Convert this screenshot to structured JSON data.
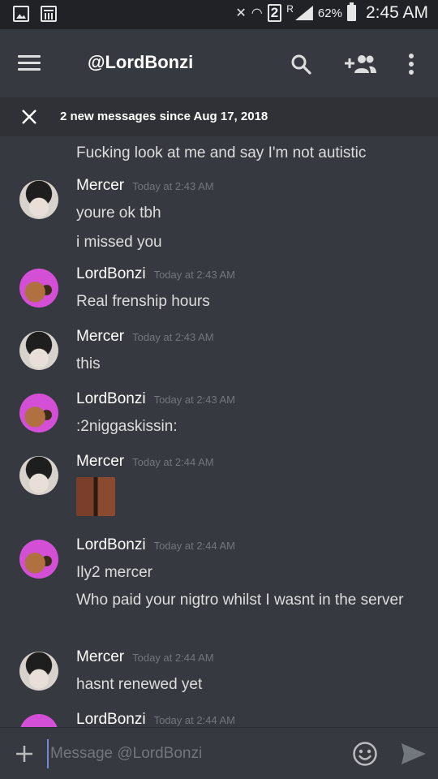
{
  "status_bar": {
    "sim_label": "2",
    "roaming": "R",
    "battery": "62%",
    "time": "2:45 AM"
  },
  "app_bar": {
    "title": "@LordBonzi"
  },
  "new_messages_bar": {
    "text": "2 new messages since Aug 17, 2018"
  },
  "messages": [
    {
      "lines": [
        "Fucking look at me and say I'm not autistic"
      ]
    },
    {
      "author": "Mercer",
      "time": "Today at 2:43 AM",
      "lines": [
        "youre ok tbh",
        "i missed you"
      ]
    },
    {
      "author": "LordBonzi",
      "time": "Today at 2:43 AM",
      "lines": [
        "Real frenship hours"
      ]
    },
    {
      "author": "Mercer",
      "time": "Today at 2:43 AM",
      "lines": [
        "this"
      ]
    },
    {
      "author": "LordBonzi",
      "time": "Today at 2:43 AM",
      "lines": [
        ":2niggaskissin:"
      ]
    },
    {
      "author": "Mercer",
      "time": "Today at 2:44 AM",
      "lines": []
    },
    {
      "author": "LordBonzi",
      "time": "Today at 2:44 AM",
      "lines": [
        "Ily2 mercer",
        "Who paid your nigtro whilst I wasnt in the server"
      ]
    },
    {
      "author": "Mercer",
      "time": "Today at 2:44 AM",
      "lines": [
        "hasnt renewed yet"
      ]
    },
    {
      "author": "LordBonzi",
      "time": "Today at 2:44 AM",
      "lines": []
    }
  ],
  "composer": {
    "placeholder": "Message @LordBonzi"
  },
  "colors": {
    "background": "#36393f",
    "status_bar": "#202225",
    "new_bar": "#2f3136",
    "timestamp": "#72767d",
    "accent": "#7289da",
    "lordbonzi_avatar": "#d34fd6"
  }
}
